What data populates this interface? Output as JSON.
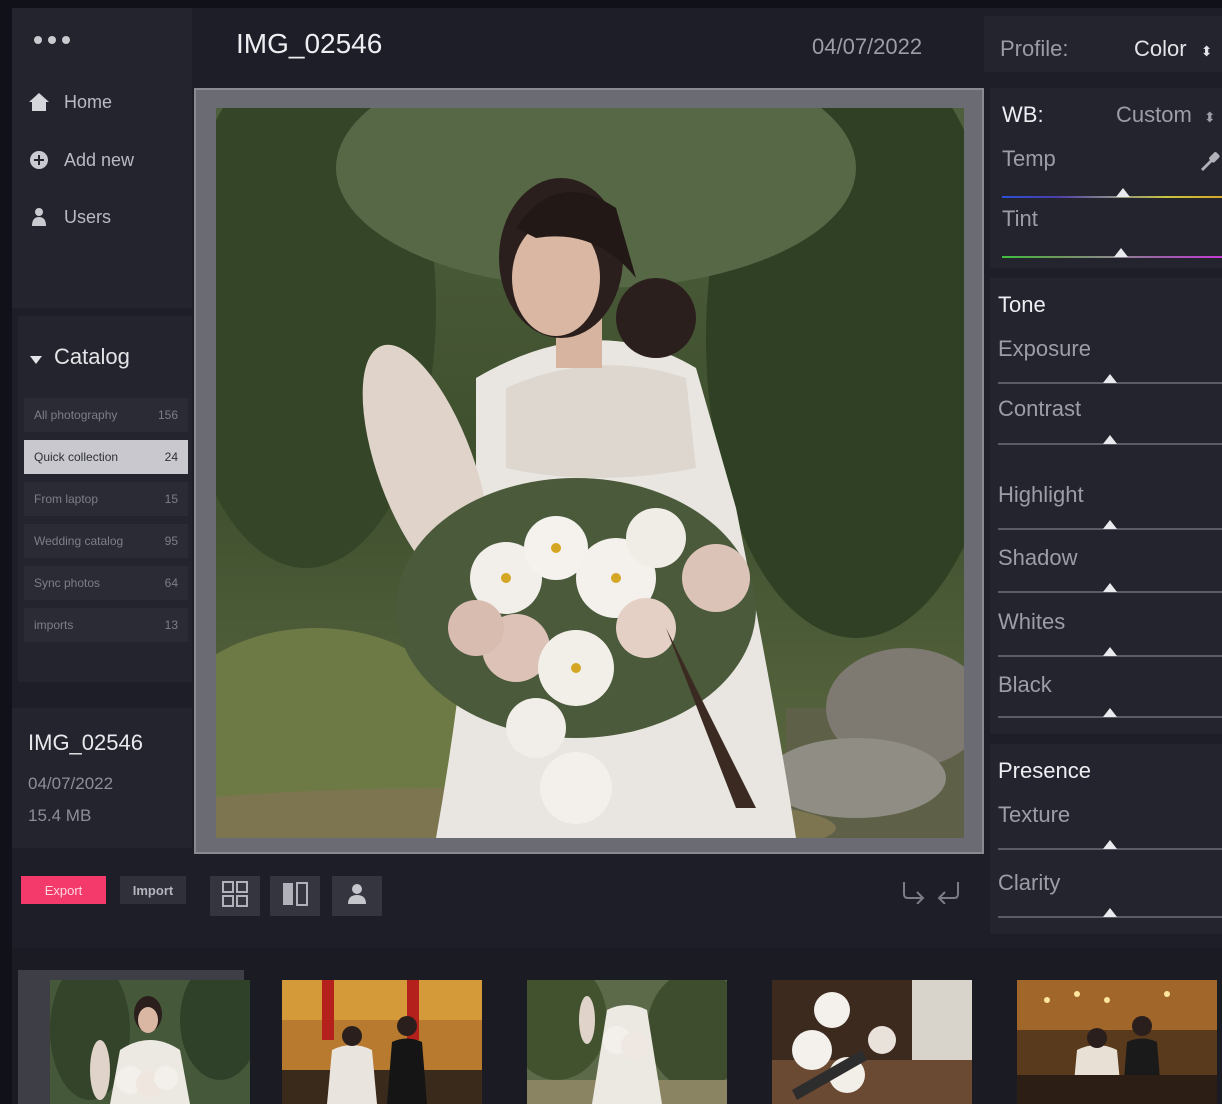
{
  "sidebar": {
    "nav": [
      {
        "label": "Home",
        "icon": "home-icon"
      },
      {
        "label": "Add new",
        "icon": "add-circle-icon"
      },
      {
        "label": "Users",
        "icon": "user-icon"
      }
    ],
    "catalog": {
      "title": "Catalog",
      "items": [
        {
          "label": "All photography",
          "count": "156",
          "active": false
        },
        {
          "label": "Quick collection",
          "count": "24",
          "active": true
        },
        {
          "label": "From laptop",
          "count": "15",
          "active": false
        },
        {
          "label": "Wedding catalog",
          "count": "95",
          "active": false
        },
        {
          "label": "Sync photos",
          "count": "64",
          "active": false
        },
        {
          "label": "imports",
          "count": "13",
          "active": false
        }
      ]
    },
    "file_info": {
      "name": "IMG_02546",
      "date": "04/07/2022",
      "size": "15.4 MB"
    },
    "export_label": "Export",
    "import_label": "Import"
  },
  "header": {
    "file_name": "IMG_02546",
    "date": "04/07/2022"
  },
  "right_panel": {
    "profile_label": "Profile:",
    "profile_value": "Color",
    "wb_label": "WB:",
    "wb_value": "Custom",
    "wb_controls": [
      {
        "label": "Temp",
        "value": 0.55
      },
      {
        "label": "Tint",
        "value": 0.54
      }
    ],
    "tone_title": "Tone",
    "tone_controls": [
      {
        "label": "Exposure",
        "value": 0.5
      },
      {
        "label": "Contrast",
        "value": 0.5
      },
      {
        "label": "Highlight",
        "value": 0.5
      },
      {
        "label": "Shadow",
        "value": 0.5
      },
      {
        "label": "Whites",
        "value": 0.5
      },
      {
        "label": "Black",
        "value": 0.5
      }
    ],
    "presence_title": "Presence",
    "presence_controls": [
      {
        "label": "Texture",
        "value": 0.5
      },
      {
        "label": "Clarity",
        "value": 0.5
      }
    ]
  },
  "colors": {
    "accent": "#f43a6b",
    "panel": "#24242e",
    "background": "#1d1e27"
  }
}
